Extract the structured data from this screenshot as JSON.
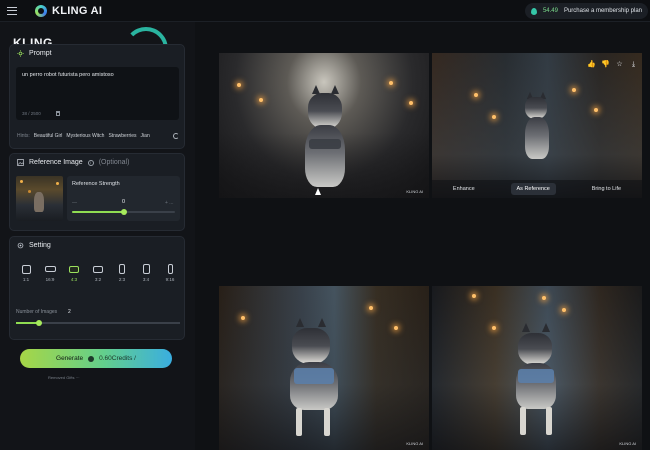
{
  "topbar": {
    "logo_text": "KLING AI",
    "credits": "54.49",
    "purchase_label": "Purchase a membership plan"
  },
  "sidebar": {
    "brand": "KLING",
    "prompt": {
      "title": "Prompt",
      "text": "un perro robot futurista pero amistoso",
      "char_count": "38 / 2500",
      "hints_label": "Hints:",
      "hints": [
        "Beautiful Girl",
        "Mysterious Witch",
        "Strawberries",
        "Jian"
      ]
    },
    "reference": {
      "title": "Reference Image",
      "optional": "(Optional)",
      "strength_label": "Reference Strength",
      "min_label": "—",
      "max_label": "+ ...",
      "strength_value": "0",
      "strength_fraction": 0.5
    },
    "setting": {
      "title": "Setting",
      "ratios": [
        {
          "label": "1:1",
          "w": 9,
          "h": 9,
          "active": false
        },
        {
          "label": "16:9",
          "w": 11,
          "h": 6,
          "active": false
        },
        {
          "label": "4:3",
          "w": 10,
          "h": 7,
          "active": true
        },
        {
          "label": "3:2",
          "w": 10,
          "h": 7,
          "active": false
        },
        {
          "label": "2:3",
          "w": 6,
          "h": 10,
          "active": false
        },
        {
          "label": "3:4",
          "w": 7,
          "h": 10,
          "active": false
        },
        {
          "label": "9:16",
          "w": 5,
          "h": 10,
          "active": false
        }
      ],
      "num_images_label": "Number of Images",
      "num_images_value": "2",
      "num_images_fraction": 0.14
    },
    "generate": {
      "label": "Generate",
      "credits": "0.60Credits /"
    },
    "footer_link": "Removed Gifts  ···"
  },
  "gallery": {
    "watermark": "KLING AI",
    "overlay_buttons": [
      "Enhance",
      "As Reference",
      "Bring to Life"
    ],
    "overlay_active_index": 1,
    "action_icons": [
      "thumbs-up-icon",
      "thumbs-down-icon",
      "star-icon",
      "download-icon"
    ]
  },
  "colors": {
    "accent_green": "#9be15d",
    "generate_gradient_start": "#a6d646",
    "generate_gradient_end": "#3aaee0",
    "credit_green": "#7bdc8c"
  }
}
